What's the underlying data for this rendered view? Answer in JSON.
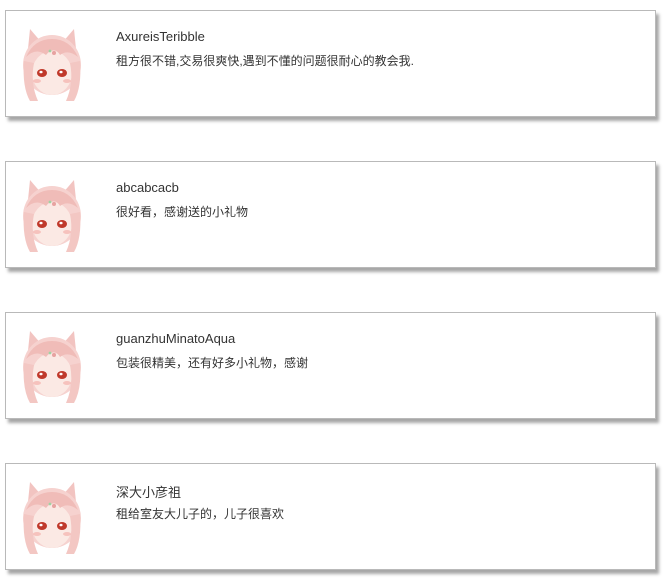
{
  "reviews": [
    {
      "username": "AxureisTeribble",
      "comment": "租方很不错,交易很爽快,遇到不懂的问题很耐心的教会我.",
      "avatar_icon": "anime-girl-avatar-icon"
    },
    {
      "username": "abcabcacb",
      "comment": "很好看，感谢送的小礼物",
      "avatar_icon": "anime-girl-avatar-icon"
    },
    {
      "username": "guanzhuMinatoAqua",
      "comment": "包装很精美，还有好多小礼物，感谢",
      "avatar_icon": "anime-girl-avatar-icon"
    },
    {
      "username": "深大小彦祖",
      "comment": "租给室友大儿子的，儿子很喜欢",
      "avatar_icon": "anime-girl-avatar-icon"
    }
  ],
  "colors": {
    "card_border": "#b9b9b9",
    "text": "#333333",
    "hair": "#f4c9c6",
    "eyes": "#c0392b"
  }
}
